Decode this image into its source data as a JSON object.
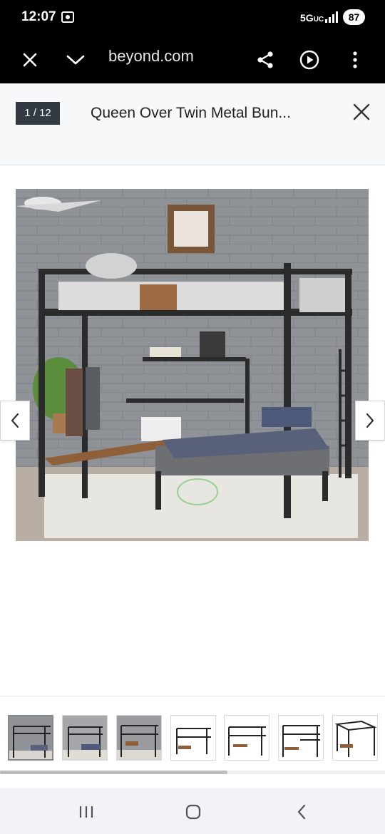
{
  "status_bar": {
    "time": "12:07",
    "network": "5G",
    "network_sub": "UC",
    "battery": "87"
  },
  "browser": {
    "url": "beyond.com",
    "icons": [
      "close-icon",
      "chevron-down-icon",
      "share-icon",
      "play-icon",
      "more-vert-icon"
    ]
  },
  "gallery": {
    "counter": "1 / 12",
    "title": "Queen Over Twin Metal Bun...",
    "thumbnail_count": 7,
    "scroll_fraction": 0.59
  },
  "android_nav": {
    "icons": [
      "recent-apps-icon",
      "home-icon",
      "back-icon"
    ]
  },
  "colors": {
    "status_bg": "#000000",
    "header_bg": "#f6f8fa",
    "counter_bg": "#333a41",
    "nav_bg": "#f2f3f7"
  }
}
